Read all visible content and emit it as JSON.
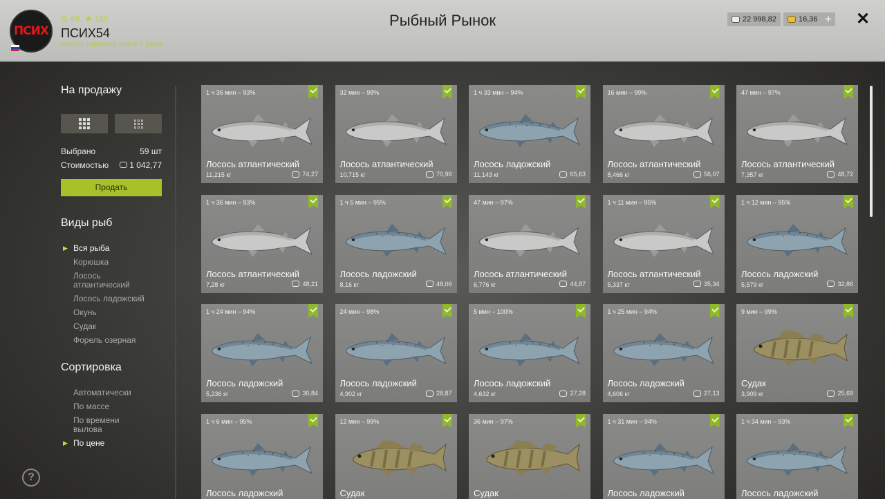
{
  "header": {
    "avatar_text": "ПСИХ",
    "level": "48",
    "stars": "110",
    "username": "ПСИХ54",
    "rank": "Мастер карповой ловли 7 ранга",
    "title": "Рыбный Рынок",
    "silver": "22 998,82",
    "gold": "16,36",
    "plus": "+",
    "close": "✕"
  },
  "sidebar": {
    "for_sale": "На продажу",
    "selected_label": "Выбрано",
    "selected_value": "59 шт",
    "cost_label": "Стоимостью",
    "cost_value": "1 042,77",
    "sell": "Продать",
    "species_heading": "Виды рыб",
    "species": [
      "Вся рыба",
      "Корюшка",
      "Лосось атлантический",
      "Лосось ладожский",
      "Окунь",
      "Судак",
      "Форель озерная"
    ],
    "species_active": 0,
    "sort_heading": "Сортировка",
    "sort": [
      "Автоматически",
      "По массе",
      "По времени вылова",
      "По цене"
    ],
    "sort_active": 3,
    "help": "?"
  },
  "colors": {
    "accent": "#a8c02a",
    "atlantic_salmon": "#c9cac8",
    "ladoga_salmon": "#8ea3b0",
    "zander": "#9c8f62"
  },
  "cards": [
    {
      "time": "1 ч 36 мин – 93%",
      "name": "Лосось атлантический",
      "weight": "11,215 кг",
      "price": "74,27",
      "kind": "atlantic"
    },
    {
      "time": "32 мин – 98%",
      "name": "Лосось атлантический",
      "weight": "10,715 кг",
      "price": "70,96",
      "kind": "atlantic"
    },
    {
      "time": "1 ч 33 мин – 94%",
      "name": "Лосось ладожский",
      "weight": "11,143 кг",
      "price": "65,63",
      "kind": "ladoga"
    },
    {
      "time": "16 мин – 99%",
      "name": "Лосось атлантический",
      "weight": "8,466 кг",
      "price": "56,07",
      "kind": "atlantic"
    },
    {
      "time": "47 мин – 97%",
      "name": "Лосось атлантический",
      "weight": "7,357 кг",
      "price": "48,72",
      "kind": "atlantic"
    },
    {
      "time": "1 ч 36 мин – 93%",
      "name": "Лосось атлантический",
      "weight": "7,28 кг",
      "price": "48,21",
      "kind": "atlantic"
    },
    {
      "time": "1 ч 5 мин – 95%",
      "name": "Лосось ладожский",
      "weight": "8,16 кг",
      "price": "48,06",
      "kind": "ladoga"
    },
    {
      "time": "47 мин – 97%",
      "name": "Лосось атлантический",
      "weight": "6,776 кг",
      "price": "44,87",
      "kind": "atlantic"
    },
    {
      "time": "1 ч 11 мин – 95%",
      "name": "Лосось атлантический",
      "weight": "5,337 кг",
      "price": "35,34",
      "kind": "atlantic"
    },
    {
      "time": "1 ч 12 мин – 95%",
      "name": "Лосось ладожский",
      "weight": "5,579 кг",
      "price": "32,86",
      "kind": "ladoga"
    },
    {
      "time": "1 ч 24 мин – 94%",
      "name": "Лосось ладожский",
      "weight": "5,236 кг",
      "price": "30,84",
      "kind": "ladoga"
    },
    {
      "time": "24 мин – 98%",
      "name": "Лосось ладожский",
      "weight": "4,902 кг",
      "price": "28,87",
      "kind": "ladoga"
    },
    {
      "time": "5 мин – 100%",
      "name": "Лосось ладожский",
      "weight": "4,632 кг",
      "price": "27,28",
      "kind": "ladoga"
    },
    {
      "time": "1 ч 25 мин – 94%",
      "name": "Лосось ладожский",
      "weight": "4,606 кг",
      "price": "27,13",
      "kind": "ladoga"
    },
    {
      "time": "9 мин – 99%",
      "name": "Судак",
      "weight": "3,909 кг",
      "price": "25,69",
      "kind": "zander"
    },
    {
      "time": "1 ч 6 мин – 95%",
      "name": "Лосось ладожский",
      "weight": "",
      "price": "",
      "kind": "ladoga"
    },
    {
      "time": "12 мин – 99%",
      "name": "Судак",
      "weight": "",
      "price": "",
      "kind": "zander"
    },
    {
      "time": "36 мин – 97%",
      "name": "Судак",
      "weight": "",
      "price": "",
      "kind": "zander"
    },
    {
      "time": "1 ч 31 мин – 94%",
      "name": "Лосось ладожский",
      "weight": "",
      "price": "",
      "kind": "ladoga"
    },
    {
      "time": "1 ч 34 мин – 93%",
      "name": "Лосось ладожский",
      "weight": "",
      "price": "",
      "kind": "ladoga"
    }
  ]
}
